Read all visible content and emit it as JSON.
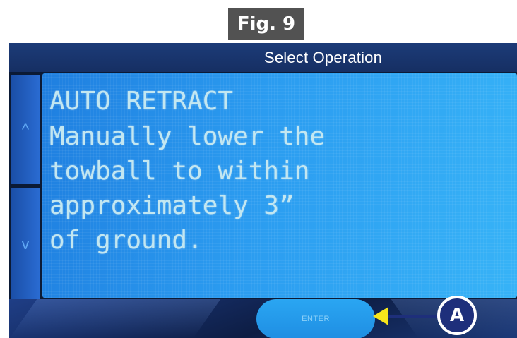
{
  "figure": {
    "label": "Fig. 9"
  },
  "screen": {
    "title": "Select Operation",
    "nav": {
      "up_symbol": "^",
      "down_symbol": "v"
    },
    "message_lines": [
      "AUTO RETRACT",
      "Manually lower the",
      "towball to within",
      "approximately 3”",
      "of ground."
    ],
    "enter_label": "ENTER"
  },
  "annotation": {
    "callout_letter": "A",
    "arrow_color": "#f6e61b",
    "badge_color": "#1e2f7b"
  }
}
